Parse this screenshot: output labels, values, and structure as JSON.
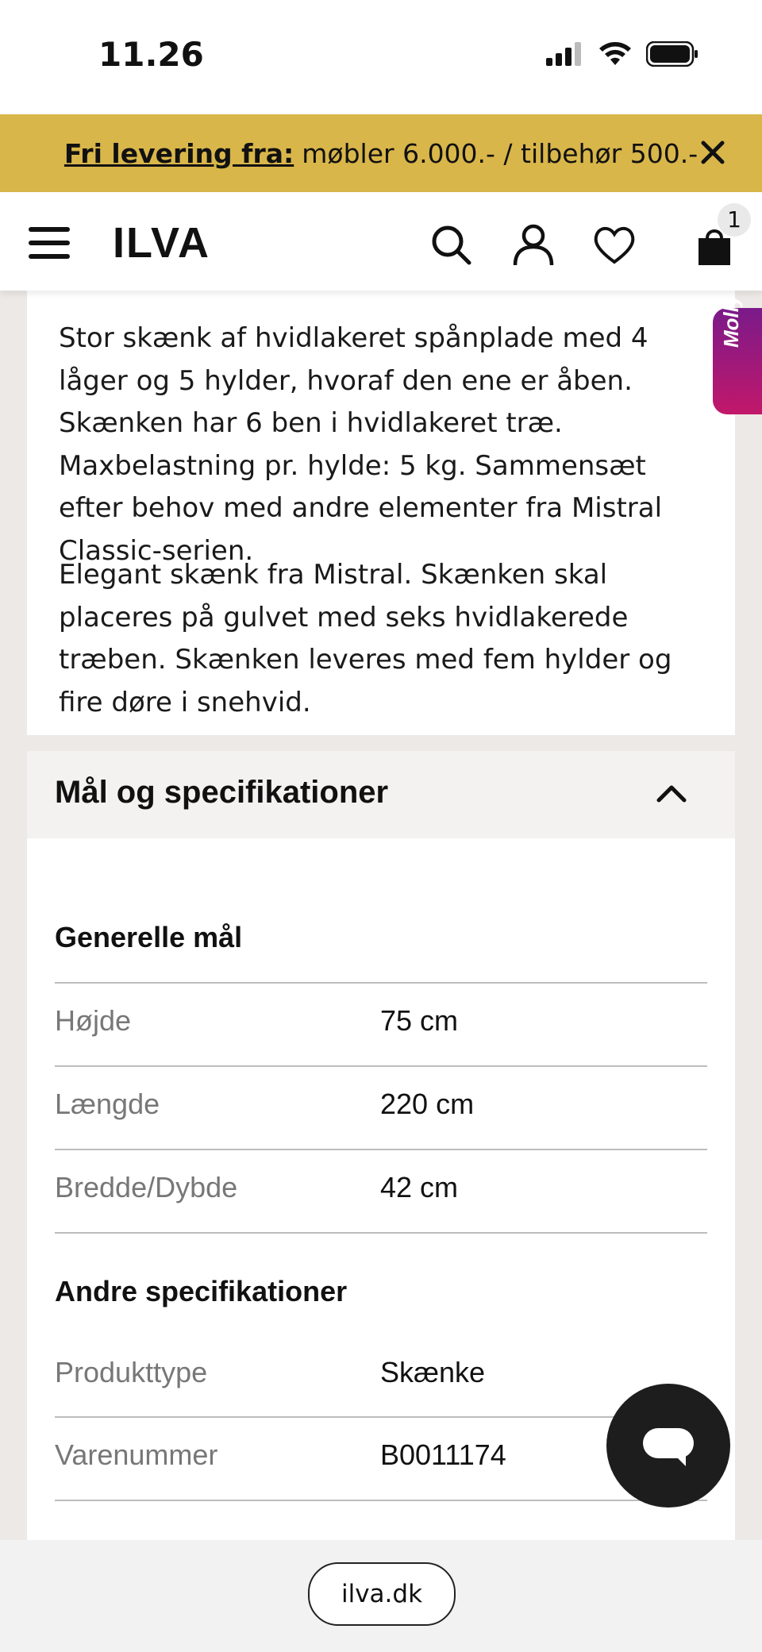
{
  "status": {
    "time": "11.26"
  },
  "banner": {
    "strong": "Fri levering fra:",
    "text": "møbler 6.000.- / tilbehør 500.-"
  },
  "header": {
    "logo": "ILVA",
    "cart_count": "1"
  },
  "molly": {
    "label": "Molly"
  },
  "description": {
    "p1": "Stor skænk af hvidlakeret spånplade med 4 låger og 5 hylder, hvoraf den ene er åben. Skænken har 6 ben i hvidlakeret træ. Maxbelastning pr. hylde: 5 kg. Sammensæt efter behov med andre elementer fra Mistral Classic-serien.",
    "p2": "Elegant skænk fra Mistral. Skænken skal placeres på gulvet med seks hvidlakerede træben. Skænken leveres med fem hylder og fire døre i snehvid."
  },
  "specs": {
    "title": "Mål og specifikationer",
    "general_title": "Generelle mål",
    "general": [
      {
        "label": "Højde",
        "value": "75 cm"
      },
      {
        "label": "Længde",
        "value": "220 cm"
      },
      {
        "label": "Bredde/Dybde",
        "value": "42 cm"
      }
    ],
    "other_title": "Andre specifikationer",
    "other": [
      {
        "label": "Produkttype",
        "value": "Skænke"
      },
      {
        "label": "Varenummer",
        "value": "B0011174"
      }
    ]
  },
  "urlbar": {
    "url": "ilva.dk"
  },
  "colors": {
    "banner": "#d9b64a",
    "molly_start": "#7a1a8a",
    "molly_end": "#c2186a",
    "chat": "#1d1d1d"
  },
  "icons": [
    "signal-icon",
    "wifi-icon",
    "battery-icon",
    "close-icon",
    "menu-icon",
    "search-icon",
    "account-icon",
    "heart-icon",
    "bag-icon",
    "chevron-up-icon",
    "chat-icon"
  ]
}
